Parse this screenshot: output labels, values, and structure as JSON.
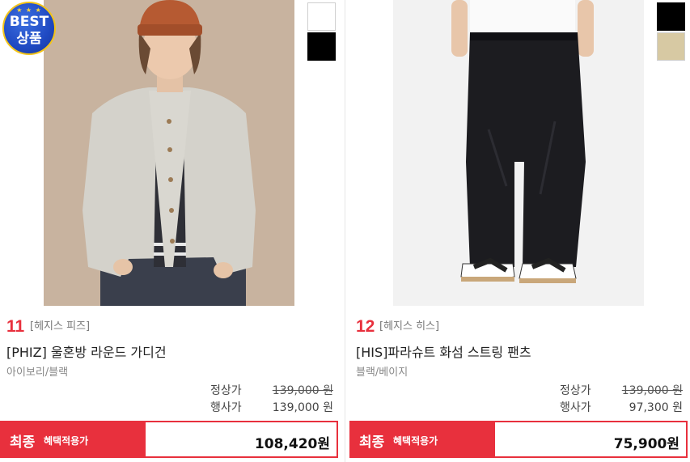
{
  "products": [
    {
      "badge": {
        "line1": "BEST",
        "line2": "상품",
        "stars": "★ ★ ★"
      },
      "swatches": [
        "#f6f6f6",
        "#000000"
      ],
      "rank": "11",
      "brand": "[헤지스 피즈]",
      "name": "[PHIZ] 울혼방 라운드 가디건",
      "colors": "아이보리/블랙",
      "regular_label": "정상가",
      "regular_price": "139,000 원",
      "event_label": "행사가",
      "event_price": "139,000 원",
      "final_main": "최종",
      "final_sub": "혜택적용가",
      "final_price": "108,420원"
    },
    {
      "swatches": [
        "#000000",
        "#d7c9a3"
      ],
      "rank": "12",
      "brand": "[헤지스 히스]",
      "name": "[HIS]파라슈트 화섬 스트링 팬츠",
      "colors": "블랙/베이지",
      "regular_label": "정상가",
      "regular_price": "139,000 원",
      "event_label": "행사가",
      "event_price": "97,300 원",
      "final_main": "최종",
      "final_sub": "혜택적용가",
      "final_price": "75,900원"
    }
  ],
  "colors": {
    "accent": "#e8303d",
    "badge_blue": "#1f49c2",
    "badge_gold": "#f3c419"
  }
}
